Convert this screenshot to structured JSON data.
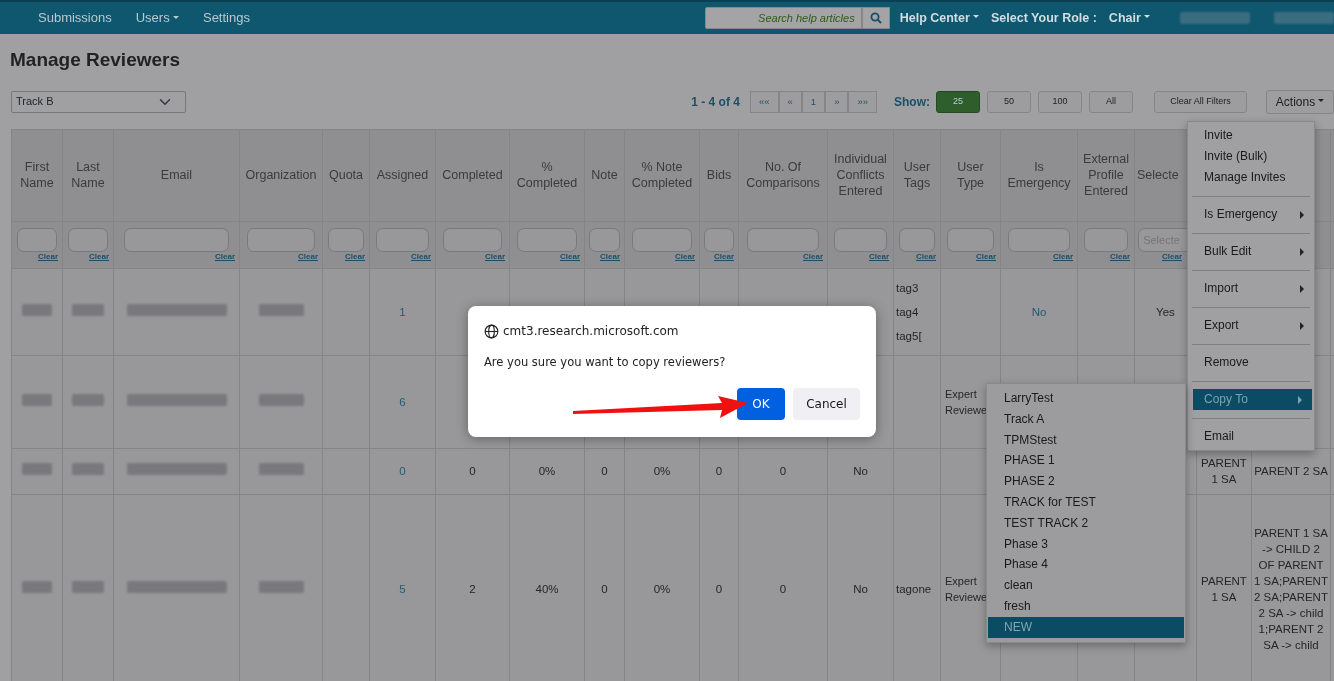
{
  "navbar": {
    "items": [
      {
        "label": "Submissions",
        "dropdown": false
      },
      {
        "label": "Users",
        "dropdown": true
      },
      {
        "label": "Settings",
        "dropdown": false
      }
    ],
    "search": {
      "placeholder": "Search help articles"
    },
    "right_items": [
      {
        "label": "Help Center",
        "dropdown": true
      },
      {
        "label": "Select Your Role :",
        "dropdown": false
      },
      {
        "label": "Chair",
        "dropdown": true
      }
    ]
  },
  "page_title": "Manage Reviewers",
  "track_select": {
    "value": "Track B"
  },
  "pagination": {
    "summary": "1 - 4 of 4",
    "buttons": [
      "««",
      "«",
      "1",
      "»",
      "»»"
    ]
  },
  "show": {
    "label": "Show:",
    "options": [
      {
        "label": "25",
        "selected": true
      },
      {
        "label": "50",
        "selected": false
      },
      {
        "label": "100",
        "selected": false
      },
      {
        "label": "All",
        "selected": false
      }
    ]
  },
  "clear_filters": "Clear All Filters",
  "actions": {
    "label": "Actions"
  },
  "table": {
    "columns": [
      "First Name",
      "Last Name",
      "Email",
      "Organization",
      "Quota",
      "Assigned",
      "Completed",
      "% Completed",
      "Note",
      "% Note Completed",
      "Bids",
      "No. Of Comparisons",
      "Individual Conflicts Entered",
      "User Tags",
      "User Type",
      "Is Emergency",
      "External Profile Entered",
      "Selecte"
    ],
    "filters": [
      {
        "clear": "Clear"
      },
      {
        "clear": "Clear"
      },
      {
        "clear": "Clear"
      },
      {
        "clear": "Clear"
      },
      {
        "clear": "Clear"
      },
      {
        "clear": "Clear"
      },
      {
        "clear": "Clear"
      },
      {
        "clear": "Clear"
      },
      {
        "clear": "Clear"
      },
      {
        "clear": "Clear"
      },
      {
        "clear": "Clear"
      },
      {
        "clear": "Clear"
      },
      {
        "clear": "Clear"
      },
      {
        "clear": "Clear"
      },
      {
        "clear": "Clear"
      },
      {
        "clear": "Clear"
      },
      {
        "clear": "Clear"
      },
      {
        "clear": "Clear",
        "placeholder": "Selecte"
      }
    ],
    "rows": [
      {
        "assigned": "1",
        "user_tags": [
          "tag3",
          "tag4",
          "tag5["
        ],
        "is_emergency": "No",
        "selected": "Yes"
      },
      {
        "assigned": "6",
        "user_type": "Expert Reviewe"
      },
      {
        "assigned": "0",
        "completed": "0",
        "pct_completed": "0%",
        "note": "0",
        "pct_note": "0%",
        "bids": "0",
        "comparisons": "0",
        "conflicts": "No",
        "column_19": "PARENT 1 SA",
        "column_20": "PARENT 2 SA"
      },
      {
        "assigned": "5",
        "completed": "2",
        "pct_completed": "40%",
        "note": "0",
        "pct_note": "0%",
        "bids": "0",
        "comparisons": "0",
        "conflicts": "No",
        "user_tags": [
          "tagone"
        ],
        "user_type": "Expert Reviewe",
        "column_19": "PARENT 1 SA",
        "column_20": "PARENT 1 SA -> CHILD 2 OF PARENT 1 SA;PARENT 2 SA;PARENT 2 SA -> child 1;PARENT 2 SA -> child"
      }
    ]
  },
  "actions_menu": {
    "groups": [
      [
        {
          "label": "Invite",
          "submenu": false,
          "selected": false
        },
        {
          "label": "Invite (Bulk)",
          "submenu": false,
          "selected": false
        },
        {
          "label": "Manage Invites",
          "submenu": false,
          "selected": false
        }
      ],
      [
        {
          "label": "Is Emergency",
          "submenu": true,
          "selected": false
        }
      ],
      [
        {
          "label": "Bulk Edit",
          "submenu": true,
          "selected": false
        }
      ],
      [
        {
          "label": "Import",
          "submenu": true,
          "selected": false
        }
      ],
      [
        {
          "label": "Export",
          "submenu": true,
          "selected": false
        }
      ],
      [
        {
          "label": "Remove",
          "submenu": false,
          "selected": false
        }
      ],
      [
        {
          "label": "Copy To",
          "submenu": true,
          "selected": true
        }
      ],
      [
        {
          "label": "Email",
          "submenu": false,
          "selected": false
        }
      ]
    ]
  },
  "copy_to_menu": {
    "items": [
      {
        "label": "LarryTest",
        "selected": false
      },
      {
        "label": "Track A",
        "selected": false
      },
      {
        "label": "TPMStest",
        "selected": false
      },
      {
        "label": "PHASE 1",
        "selected": false
      },
      {
        "label": "PHASE 2",
        "selected": false
      },
      {
        "label": "TRACK for TEST",
        "selected": false
      },
      {
        "label": "TEST TRACK 2",
        "selected": false
      },
      {
        "label": "Phase 3",
        "selected": false
      },
      {
        "label": "Phase 4",
        "selected": false
      },
      {
        "label": "clean",
        "selected": false
      },
      {
        "label": "fresh",
        "selected": false
      },
      {
        "label": "NEW",
        "selected": true
      }
    ]
  },
  "dialog": {
    "origin": "cmt3.research.microsoft.com",
    "message": "Are you sure you want to copy reviewers?",
    "buttons": [
      {
        "label": "OK",
        "kind": "primary"
      },
      {
        "label": "Cancel",
        "kind": "secondary"
      }
    ]
  }
}
